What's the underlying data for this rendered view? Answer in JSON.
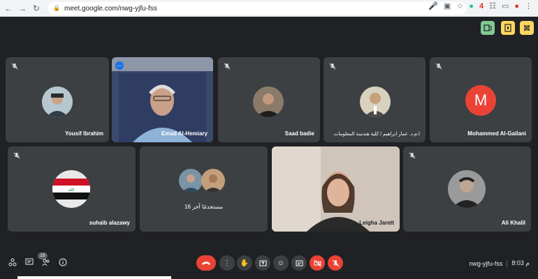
{
  "browser": {
    "url": "meet.google.com/nwg-yjfu-fss"
  },
  "participants": [
    {
      "name": "Yousif Ibrahim"
    },
    {
      "name": "Emad Al-Hemiary"
    },
    {
      "name": "Saad badie"
    },
    {
      "name": "ا.م.د. عمار ابراهيم / كلية هندسة المعلومات"
    },
    {
      "name": "Mohammed Al-Gailani",
      "avatar_letter": "M",
      "avatar_color": "#ea4335"
    },
    {
      "name": "suhaib alazawy"
    },
    {
      "name": "16 مستخدمًا آخر"
    },
    {
      "name": "Leigha Jarett"
    },
    {
      "name": "Ali Khalil"
    }
  ],
  "bottom": {
    "people_count": "23",
    "meeting_code": "nwg-yjfu-fss",
    "time": "8:03 م"
  },
  "colors": {
    "background": "#202124",
    "tile": "#3c4043",
    "red": "#ea4335",
    "active_border": "#8ab4f8",
    "green_btn": "#81c995",
    "yellow_btn": "#fdd663"
  }
}
